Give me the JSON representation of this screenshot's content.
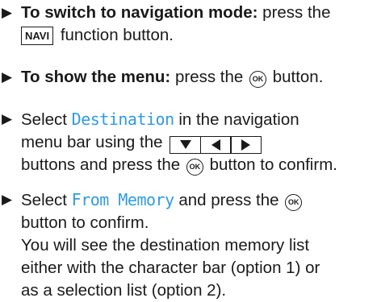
{
  "steps": [
    {
      "lead": "To switch to navigation mode:",
      "text1": " press the",
      "key": "NAVI",
      "text2": "function button."
    },
    {
      "lead": "To show the menu:",
      "text1": " press the",
      "button": "OK",
      "text2": "button."
    },
    {
      "text1": "Select ",
      "term": "Destination",
      "text2": " in the navigation",
      "line2": "menu bar using the",
      "keys": [
        "down-triangle-icon",
        "left-triangle-icon",
        "right-triangle-icon"
      ],
      "line3a": "buttons and press the",
      "button": "OK",
      "line3b": "button to confirm."
    },
    {
      "text1": "Select ",
      "term": "From Memory",
      "text2": " and press the",
      "button": "OK",
      "line2": "button to confirm.",
      "line3": "You will see the destination memory list",
      "line4": "either with the character bar (option 1) or",
      "line5": "as a selection list (option 2)."
    }
  ],
  "colors": {
    "text": "#1a1a1a",
    "term": "#2f9be3"
  }
}
